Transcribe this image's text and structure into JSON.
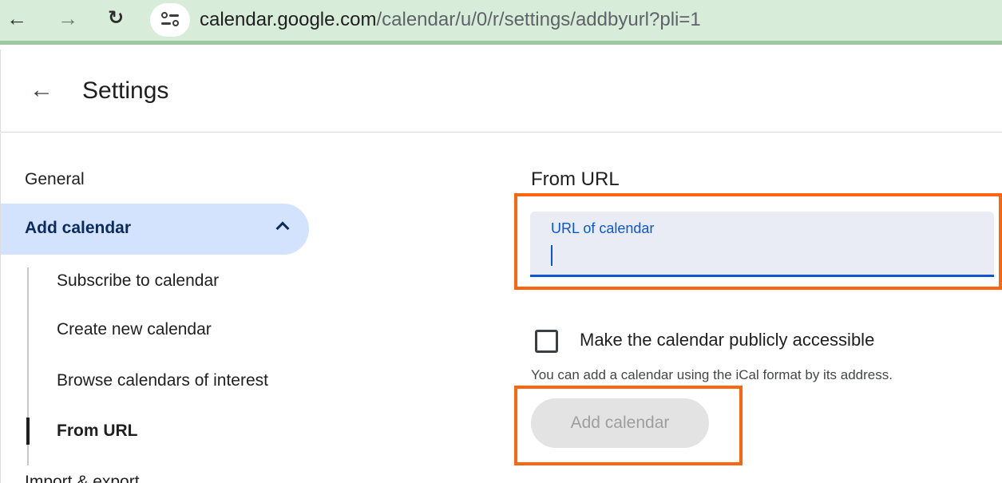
{
  "browser": {
    "url_host": "calendar.google.com",
    "url_path": "/calendar/u/0/r/settings/addbyurl?pli=1",
    "icons": {
      "back": "arrow-left-icon",
      "forward": "arrow-right-icon",
      "reload": "reload-icon",
      "site_info": "tune-icon"
    }
  },
  "header": {
    "title": "Settings",
    "back_icon": "arrow-left-icon"
  },
  "sidebar": {
    "general": "General",
    "add_calendar": "Add calendar",
    "add_calendar_expanded": true,
    "sub_items": [
      {
        "label": "Subscribe to calendar",
        "active": false
      },
      {
        "label": "Create new calendar",
        "active": false
      },
      {
        "label": "Browse calendars of interest",
        "active": false
      },
      {
        "label": "From URL",
        "active": true
      }
    ],
    "import_export": "Import & export"
  },
  "main": {
    "section_title": "From URL",
    "url_field": {
      "label": "URL of calendar",
      "value": ""
    },
    "public_checkbox": {
      "label": "Make the calendar publicly accessible",
      "checked": false
    },
    "help_text": "You can add a calendar using the iCal format by its address.",
    "add_button": "Add calendar"
  },
  "colors": {
    "accent": "#0b57d0",
    "highlight": "#fd6610",
    "selected_nav": "#d3e3fd",
    "addressbar": "#d7ecd9"
  }
}
